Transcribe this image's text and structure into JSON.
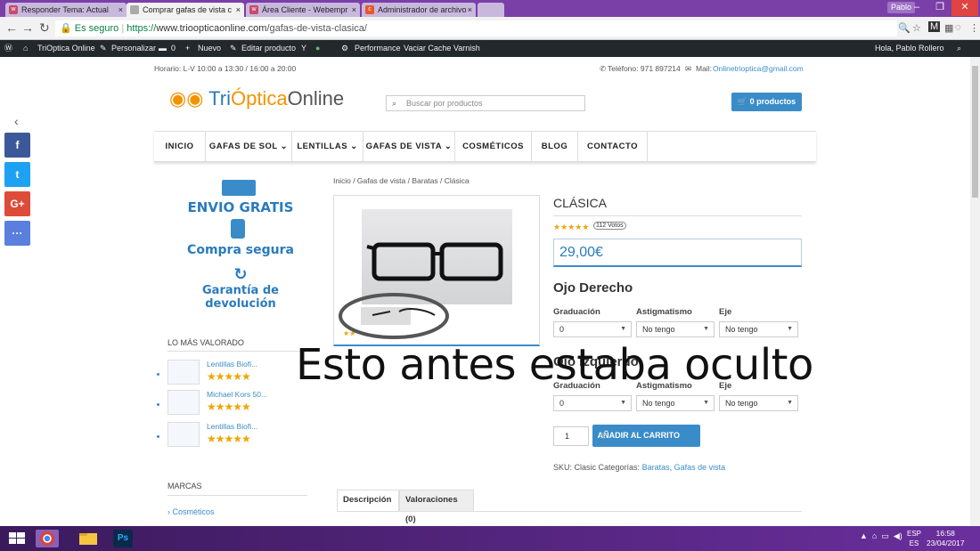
{
  "browser": {
    "tabs": [
      {
        "title": "Responder Tema: Actual",
        "icon": "wm-icon",
        "icon_color": "#c94a6a"
      },
      {
        "title": "Comprar gafas de vista c",
        "icon": "page-icon",
        "icon_color": "#888888"
      },
      {
        "title": "Área Cliente - Webempr",
        "icon": "wm-icon",
        "icon_color": "#c94a6a"
      },
      {
        "title": "Administrador de archivo",
        "icon": "cp-icon",
        "icon_color": "#e8562a"
      }
    ],
    "profile": "Pablo",
    "url_secure": "Es seguro",
    "url_scheme": "https://",
    "url_host": "www.trioopticaonline.com",
    "url_path": "/gafas-de-vista-clasica/"
  },
  "wpbar": {
    "site": "TriOptica Online",
    "customize": "Personalizar",
    "comments": "0",
    "new": "Nuevo",
    "edit": "Editar producto",
    "performance": "Performance",
    "cache": "Vaciar Cache Varnish",
    "greeting": "Hola, Pablo Rollero"
  },
  "share": {
    "back": "‹",
    "buttons": [
      {
        "label": "f",
        "color": "#3b5998"
      },
      {
        "label": "t",
        "color": "#1da1f2"
      },
      {
        "label": "G+",
        "color": "#dd4b39"
      },
      {
        "label": "···",
        "color": "#5b7fde"
      }
    ]
  },
  "header": {
    "hours": "Horario: L-V 10:00 a 13:30 / 16:00 a 20:00",
    "phone": "Teléfono: 971 897214",
    "mail_label": "Mail:",
    "mail": "Onlinetrioptica@gmail.com",
    "logo_a": "Tri",
    "logo_b": "Óptica",
    "logo_c": "Online",
    "search_placeholder": "Buscar por productos",
    "cart": "0 productos"
  },
  "menu": [
    "INICIO",
    "GAFAS DE SOL ⌄",
    "LENTILLAS ⌄",
    "GAFAS DE VISTA ⌄",
    "COSMÉTICOS",
    "BLOG",
    "CONTACTO"
  ],
  "sidebar": {
    "promo1": "ENVIO GRATIS",
    "promo2": "Compra segura",
    "promo3": "Garantía de devolución",
    "top_title": "LO MÁS VALORADO",
    "top_items": [
      {
        "name": "Lentillas Biofi...",
        "stars": "★★★★★"
      },
      {
        "name": "Michael Kors 50...",
        "stars": "★★★★★"
      },
      {
        "name": "Lentillas Biofi...",
        "stars": "★★★★★"
      }
    ],
    "brands_title": "MARCAS",
    "brand_first": "› Cosméticos"
  },
  "product": {
    "breadcrumb": "Inicio / Gafas de vista / Baratas / Clásica",
    "title": "CLÁSICA",
    "stars": "★★★★★",
    "votes": "112 Votos",
    "price": "29,00€",
    "right_eye": "Ojo Derecho",
    "left_eye": "Ojo Izquierdo",
    "grad_label": "Graduación",
    "astig_label": "Astigmatismo",
    "axis_label": "Eje",
    "grad_value": "0",
    "astig_value": "No tengo",
    "axis_value": "No tengo",
    "qty": "1",
    "add_to_cart": "AÑADIR AL CARRITO",
    "sku_text": "SKU: Clasic Categorías:",
    "cat1": "Baratas",
    "cat2": "Gafas de vista",
    "tab1": "Descripción",
    "tab2": "Valoraciones (0)"
  },
  "overlay": "Esto antes estaba oculto",
  "taskbar": {
    "lang1": "ESP",
    "lang2": "ES",
    "time": "16:58",
    "date": "23/04/2017"
  }
}
